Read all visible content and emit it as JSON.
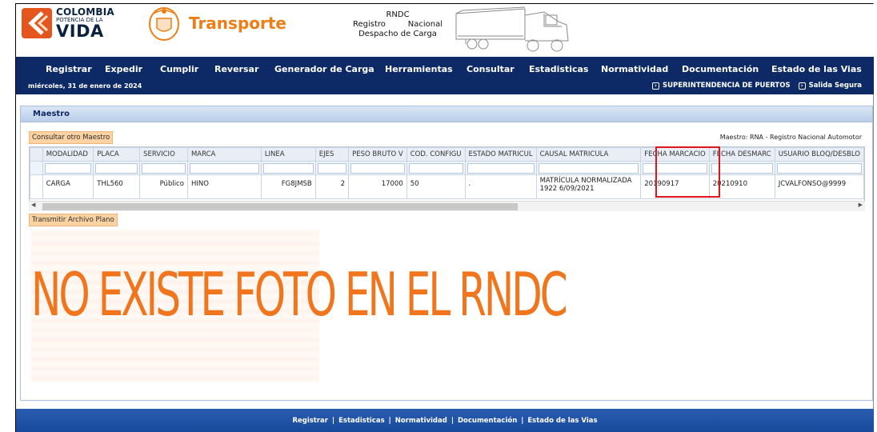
{
  "header": {
    "logo_line1": "COLOMBIA",
    "logo_line2": "POTENCIA DE LA",
    "logo_line3": "VIDA",
    "section": "Transporte",
    "rndc_title": "RNDC",
    "rndc_line2": "Registro Nacional",
    "rndc_line3": "Despacho de Carga"
  },
  "nav": {
    "items": [
      "Registrar",
      "Expedir",
      "Cumplir",
      "Reversar",
      "Generador de Carga",
      "Herramientas",
      "Consultar",
      "Estadisticas",
      "Normatividad",
      "Documentación",
      "Estado de las Vias"
    ],
    "date": "miércoles, 31 de enero de 2024",
    "link_superintendencia": "SUPERINTENDENCIA DE PUERTOS",
    "link_salida": "Salida Segura"
  },
  "panel": {
    "title": "Maestro",
    "consultar_button": "Consultar otro Maestro",
    "maestro_label": "Maestro: RNA - Registro Nacional Automotor",
    "transmitir_button": "Transmitir Archivo Plano",
    "no_photo_text": "NO EXISTE FOTO EN EL RNDC"
  },
  "grid": {
    "columns": [
      "MODALIDAD",
      "PLACA",
      "SERVICIO",
      "MARCA",
      "LINEA",
      "EJES",
      "PESO BRUTO V",
      "COD. CONFIGU",
      "ESTADO MATRICUL",
      "CAUSAL MATRICULA",
      "FECHA MARCACIO",
      "FECHA DESMARC",
      "USUARIO BLOQ/DESBLO"
    ],
    "row": {
      "modalidad": "CARGA",
      "placa": "THL560",
      "servicio": "Público",
      "marca": "HINO",
      "linea": "FG8JMSB",
      "ejes": "2",
      "peso": "17000",
      "cod": "50",
      "estado": ".",
      "causal_line1": "MATRÍCULA NORMALIZADA",
      "causal_line2": "1922 6/09/2021",
      "fecha_marcacion": "20190917",
      "fecha_desmarc": "20210910",
      "usuario": "JCVALFONSO@9999"
    }
  },
  "footer": {
    "links": [
      "Registrar",
      "Estadisticas",
      "Normatividad",
      "Documentación",
      "Estado de las Vias"
    ],
    "separator": "|"
  },
  "colors": {
    "nav_bg": "#0e2a66",
    "accent_orange": "#ef7d16",
    "highlight_red": "#e0141c",
    "footer_bg": "#1f54a6"
  }
}
